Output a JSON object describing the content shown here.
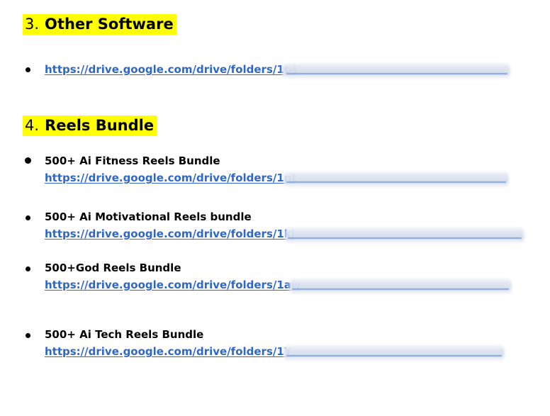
{
  "sections": [
    {
      "number": "3.",
      "title": "Other Software"
    },
    {
      "number": "4.",
      "title": "Reels Bundle"
    }
  ],
  "other_software": {
    "link": "https://drive.google.com/drive/folders/1p§"
  },
  "reels": [
    {
      "title": "500+ Ai Fitness Reels Bundle",
      "link": "https://drive.google.com/drive/folders/1nt"
    },
    {
      "title": "500+ Ai Motivational Reels bundle",
      "link": "https://drive.google.com/drive/folders/1kj"
    },
    {
      "title": "500+God Reels Bundle",
      "link": "https://drive.google.com/drive/folders/1aw"
    },
    {
      "title": "500+ Ai Tech Reels Bundle",
      "link": "https://drive.google.com/drive/folders/1Y"
    }
  ],
  "colors": {
    "highlight": "#ffff00",
    "link": "#2f67c9",
    "text": "#000000"
  }
}
